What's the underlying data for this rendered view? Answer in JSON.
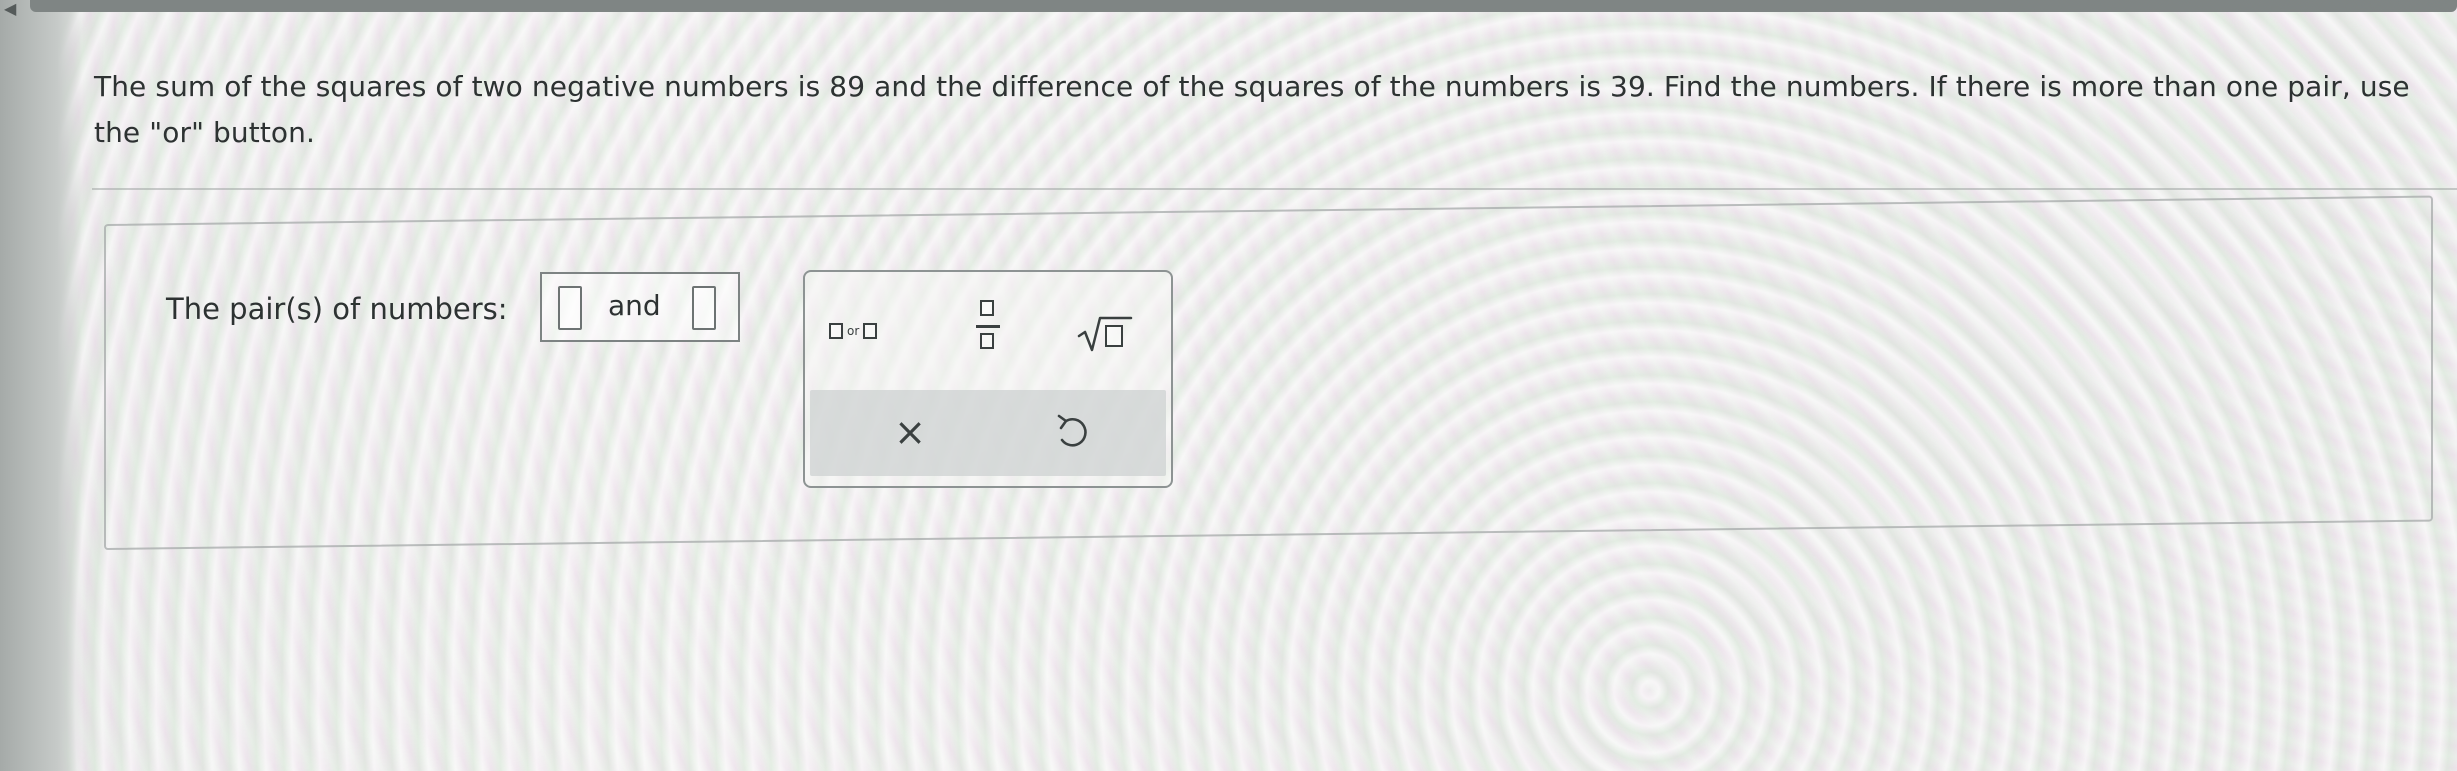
{
  "question": {
    "text": "The sum of the squares of two negative numbers is 89 and the difference of the squares of the numbers is 39. Find the numbers. If there is more than one pair, use the \"or\" button."
  },
  "answer": {
    "label": "The pair(s) of numbers:",
    "connector": "and",
    "first_value": "",
    "second_value": ""
  },
  "toolbox": {
    "or_label": "or",
    "tools": [
      {
        "name": "or-tool",
        "icon": "box-or-box-icon"
      },
      {
        "name": "fraction-tool",
        "icon": "fraction-icon"
      },
      {
        "name": "square-root-tool",
        "icon": "sqrt-icon"
      }
    ],
    "actions": [
      {
        "name": "clear",
        "icon": "close-icon",
        "glyph": "×"
      },
      {
        "name": "undo",
        "icon": "undo-icon"
      }
    ]
  },
  "colors": {
    "text": "#2d3232",
    "border": "#7d8383",
    "action_bar": "#cdd2d2"
  }
}
